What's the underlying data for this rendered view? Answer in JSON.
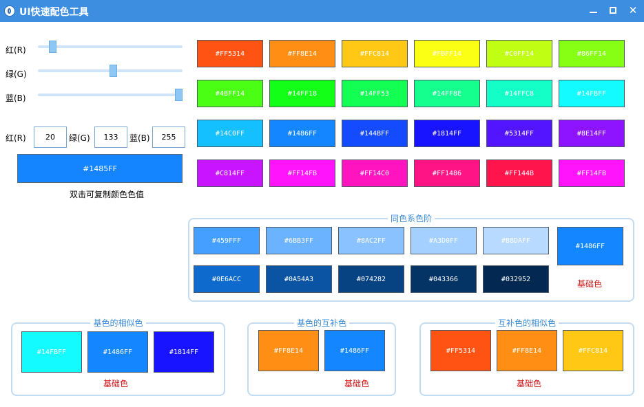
{
  "window": {
    "title": "UI快速配色工具",
    "controls": {
      "minimize": "minimize",
      "maximize": "maximize",
      "close": "✕"
    }
  },
  "sliders": [
    {
      "label": "红(R)",
      "value": 20,
      "max": 255
    },
    {
      "label": "绿(G)",
      "value": 133,
      "max": 255
    },
    {
      "label": "蓝(B)",
      "value": 255,
      "max": 255
    }
  ],
  "rgb_inputs": [
    {
      "label": "红(R)",
      "value": "20"
    },
    {
      "label": "绿(G)",
      "value": "133"
    },
    {
      "label": "蓝(B)",
      "value": "255"
    }
  ],
  "preview": {
    "hex": "#1485FF",
    "color": "#1485FF"
  },
  "hint": "双击可复制颜色色值",
  "palette": [
    [
      {
        "label": "#FF5314",
        "color": "#FF5314"
      },
      {
        "label": "#FF8E14",
        "color": "#FF8E14"
      },
      {
        "label": "#FFC814",
        "color": "#FFC814"
      },
      {
        "label": "#FBFF14",
        "color": "#FBFF14"
      },
      {
        "label": "#C0FF14",
        "color": "#C0FF14"
      },
      {
        "label": "#86FF14",
        "color": "#86FF14"
      }
    ],
    [
      {
        "label": "#4BFF14",
        "color": "#4BFF14"
      },
      {
        "label": "#14FF18",
        "color": "#14FF18"
      },
      {
        "label": "#14FF53",
        "color": "#14FF53"
      },
      {
        "label": "#14FF8E",
        "color": "#14FF8E"
      },
      {
        "label": "#14FFC8",
        "color": "#14FFC8"
      },
      {
        "label": "#14FBFF",
        "color": "#14FBFF"
      }
    ],
    [
      {
        "label": "#14C0FF",
        "color": "#14C0FF"
      },
      {
        "label": "#1486FF",
        "color": "#1486FF"
      },
      {
        "label": "#144BFF",
        "color": "#144BFF"
      },
      {
        "label": "#1814FF",
        "color": "#1814FF"
      },
      {
        "label": "#5314FF",
        "color": "#5314FF"
      },
      {
        "label": "#8E14FF",
        "color": "#8E14FF"
      }
    ],
    [
      {
        "label": "#C814FF",
        "color": "#C814FF"
      },
      {
        "label": "#FF14FB",
        "color": "#FF14FB"
      },
      {
        "label": "#FF14C0",
        "color": "#FF14C0"
      },
      {
        "label": "#FF1486",
        "color": "#FF1486"
      },
      {
        "label": "#FF144B",
        "color": "#FF144B"
      },
      {
        "label": "#FF14FB",
        "color": "#FF14FB"
      }
    ]
  ],
  "same_hue": {
    "title": "同色系色阶",
    "lighter": [
      {
        "label": "#459FFF",
        "color": "#459FFF"
      },
      {
        "label": "#6BB3FF",
        "color": "#6BB3FF"
      },
      {
        "label": "#8AC2FF",
        "color": "#8AC2FF"
      },
      {
        "label": "#A3D0FF",
        "color": "#A3D0FF"
      },
      {
        "label": "#B8DAFF",
        "color": "#B8DAFF"
      }
    ],
    "darker": [
      {
        "label": "#0E6ACC",
        "color": "#0E6ACC"
      },
      {
        "label": "#0A54A3",
        "color": "#0A54A3"
      },
      {
        "label": "#074282",
        "color": "#074282"
      },
      {
        "label": "#043366",
        "color": "#043366"
      },
      {
        "label": "#032952",
        "color": "#032952"
      }
    ],
    "base": {
      "label": "#1486FF",
      "color": "#1486FF"
    },
    "base_label": "基础色"
  },
  "analogous": {
    "title": "基色的相似色",
    "swatches": [
      {
        "label": "#14FBFF",
        "color": "#14FBFF"
      },
      {
        "label": "#1486FF",
        "color": "#1486FF"
      },
      {
        "label": "#1814FF",
        "color": "#1814FF"
      }
    ],
    "base_label": "基础色"
  },
  "complementary": {
    "title": "基色的互补色",
    "swatches": [
      {
        "label": "#FF8E14",
        "color": "#FF8E14"
      },
      {
        "label": "#1486FF",
        "color": "#1486FF"
      }
    ],
    "base_label": "基础色"
  },
  "complement_analogous": {
    "title": "互补色的相似色",
    "swatches": [
      {
        "label": "#FF5314",
        "color": "#FF5314"
      },
      {
        "label": "#FF8E14",
        "color": "#FF8E14"
      },
      {
        "label": "#FFC814",
        "color": "#FFC814"
      }
    ],
    "base_label": "基础色"
  }
}
